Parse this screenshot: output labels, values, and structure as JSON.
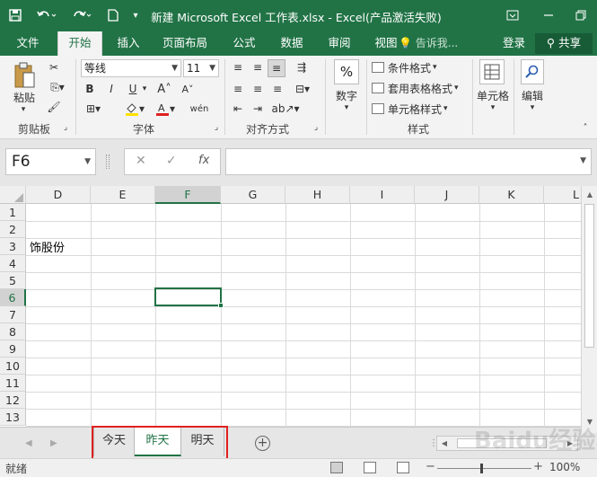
{
  "title": "新建 Microsoft Excel 工作表.xlsx - Excel(产品激活失败)",
  "quick_access": {
    "save_icon": "save-icon",
    "undo_icon": "undo-icon",
    "redo_icon": "redo-icon",
    "new_icon": "new-file-icon",
    "customize_icon": "customize-qat-icon"
  },
  "window_controls": {
    "ribbon_display_icon": "ribbon-display-icon",
    "minimize_icon": "minimize-icon",
    "restore_icon": "restore-icon"
  },
  "ribbon_tabs": [
    "文件",
    "开始",
    "插入",
    "页面布局",
    "公式",
    "数据",
    "审阅",
    "视图"
  ],
  "active_tab": "开始",
  "tell_me": "告诉我...",
  "login": "登录",
  "share": "共享",
  "ribbon": {
    "clipboard": {
      "paste": "粘贴",
      "label": "剪贴板"
    },
    "font": {
      "name": "等线",
      "size": "11",
      "bold": "B",
      "italic": "I",
      "underline": "U",
      "fill_char": "wén",
      "label": "字体"
    },
    "alignment": {
      "label": "对齐方式"
    },
    "number": {
      "percent": "%",
      "label": "数字"
    },
    "styles": {
      "conditional": "条件格式",
      "table_format": "套用表格格式",
      "cell_styles": "单元格样式",
      "label": "样式"
    },
    "cells": {
      "label": "单元格"
    },
    "editing": {
      "label": "编辑"
    }
  },
  "formula_bar": {
    "name_box": "F6",
    "cancel": "✕",
    "enter": "✓",
    "fx": "fx",
    "formula": ""
  },
  "grid": {
    "columns": [
      "D",
      "E",
      "F",
      "G",
      "H",
      "I",
      "J",
      "K",
      "L"
    ],
    "selected_column": "F",
    "rows": [
      "1",
      "2",
      "3",
      "4",
      "5",
      "6",
      "7",
      "8",
      "9",
      "10",
      "11",
      "12",
      "13"
    ],
    "selected_row": "6",
    "cells": {
      "D3": "饰股份"
    },
    "active_cell": "F6"
  },
  "sheets": [
    "今天",
    "昨天",
    "明天"
  ],
  "active_sheet": "昨天",
  "status": {
    "ready": "就绪",
    "zoom": "100%",
    "zoom_minus": "−",
    "zoom_plus": "+"
  },
  "watermark": "Baidu经验",
  "colors": {
    "brand": "#217346",
    "highlight": "#e02020"
  }
}
